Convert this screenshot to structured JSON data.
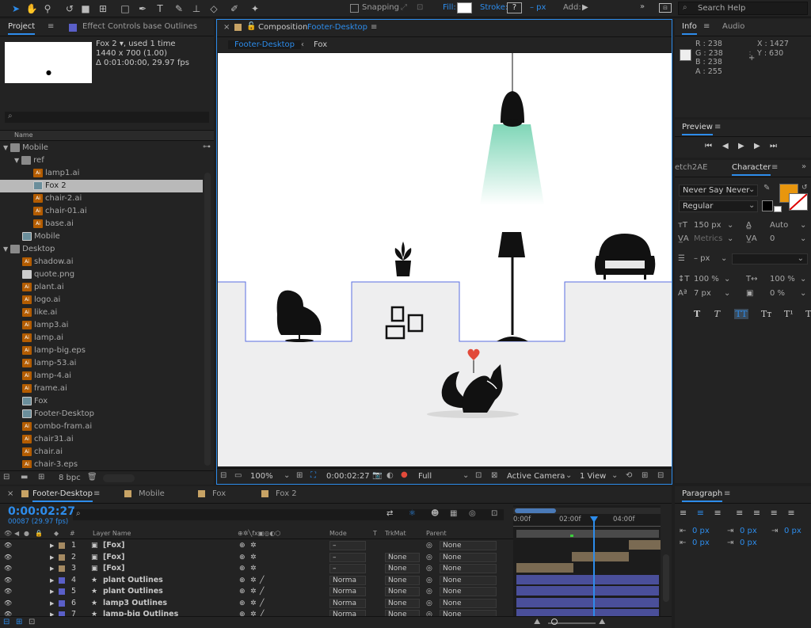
{
  "toolbar": {
    "snapping": "Snapping",
    "fill": "Fill:",
    "stroke": "Stroke:",
    "stroke_value": "?",
    "px": "– px",
    "add": "Add:",
    "search": "Search Help"
  },
  "project": {
    "tab_project": "Project",
    "tab_effect": "Effect Controls base Outlines",
    "item_name": "Fox 2 ▾, used 1 time",
    "item_size": "1440 x 700 (1.00)",
    "item_dur": "Δ 0:01:00:00, 29.97 fps",
    "col_name": "Name",
    "bpc": "8 bpc",
    "items": [
      {
        "label": "Mobile",
        "type": "fold"
      },
      {
        "label": "ref",
        "type": "fold"
      },
      {
        "label": "lamp1.ai",
        "type": "ai"
      },
      {
        "label": "Fox 2",
        "type": "comp"
      },
      {
        "label": "chair-2.ai",
        "type": "ai"
      },
      {
        "label": "chair-01.ai",
        "type": "ai"
      },
      {
        "label": "base.ai",
        "type": "ai"
      },
      {
        "label": "Mobile",
        "type": "comp"
      },
      {
        "label": "Desktop",
        "type": "fold"
      },
      {
        "label": "shadow.ai",
        "type": "ai"
      },
      {
        "label": "quote.png",
        "type": "png"
      },
      {
        "label": "plant.ai",
        "type": "ai"
      },
      {
        "label": "logo.ai",
        "type": "ai"
      },
      {
        "label": "like.ai",
        "type": "ai"
      },
      {
        "label": "lamp3.ai",
        "type": "ai"
      },
      {
        "label": "lamp.ai",
        "type": "ai"
      },
      {
        "label": "lamp-big.eps",
        "type": "ai"
      },
      {
        "label": "lamp-53.ai",
        "type": "ai"
      },
      {
        "label": "lamp-4.ai",
        "type": "ai"
      },
      {
        "label": "frame.ai",
        "type": "ai"
      },
      {
        "label": "Fox",
        "type": "comp"
      },
      {
        "label": "Footer-Desktop",
        "type": "comp"
      },
      {
        "label": "combo-fram.ai",
        "type": "ai"
      },
      {
        "label": "chair31.ai",
        "type": "ai"
      },
      {
        "label": "chair.ai",
        "type": "ai"
      },
      {
        "label": "chair-3.eps",
        "type": "ai"
      }
    ]
  },
  "composition": {
    "tab_prefix": "Composition",
    "tab_name": "Footer-Desktop",
    "crumb1": "Footer-Desktop",
    "crumb2": "Fox",
    "zoom": "100%",
    "time": "0:00:02:27",
    "res": "Full",
    "camera": "Active Camera",
    "view": "1 View"
  },
  "info": {
    "tab": "Info",
    "tab2": "Audio",
    "r": "R : 238",
    "g": "G : 238",
    "b": "B : 238",
    "a": "A : 255",
    "x": "X : 1427",
    "y": "Y : 630"
  },
  "preview": {
    "tab": "Preview"
  },
  "character": {
    "tab_left": "etch2AE",
    "tab": "Character",
    "font": "Never Say Never",
    "style": "Regular",
    "size": "150 px",
    "leading": "Auto",
    "kern": "Metrics",
    "track": "0",
    "stroke_px": "– px",
    "vscale": "100 %",
    "hscale": "100 %",
    "baseline": "7 px",
    "tsume": "0 %",
    "swatch": "#e8960e"
  },
  "paragraph": {
    "tab": "Paragraph",
    "v1": "0 px",
    "v2": "0 px",
    "v3": "0 px",
    "v4": "0 px",
    "v5": "0 px"
  },
  "timeline": {
    "tabs": [
      "Footer-Desktop",
      "Mobile",
      "Fox",
      "Fox 2"
    ],
    "time": "0:00:02:27",
    "frames": "00087 (29.97 fps)",
    "col_layer": "Layer Name",
    "col_mode": "Mode",
    "col_t": "T",
    "col_trk": "TrkMat",
    "col_parent": "Parent",
    "ruler": [
      "0:00f",
      "02:00f",
      "04:00f"
    ],
    "layers": [
      {
        "num": "1",
        "name": "[Fox]",
        "mode": "–",
        "trk": "",
        "parent": "None",
        "color": "#a58a62"
      },
      {
        "num": "2",
        "name": "[Fox]",
        "mode": "–",
        "trk": "None",
        "parent": "None",
        "color": "#a58a62"
      },
      {
        "num": "3",
        "name": "[Fox]",
        "mode": "–",
        "trk": "None",
        "parent": "None",
        "color": "#a58a62"
      },
      {
        "num": "4",
        "name": "plant Outlines",
        "mode": "Norma",
        "trk": "None",
        "parent": "None",
        "color": "#5a5fc8"
      },
      {
        "num": "5",
        "name": "plant Outlines",
        "mode": "Norma",
        "trk": "None",
        "parent": "None",
        "color": "#5a5fc8"
      },
      {
        "num": "6",
        "name": "lamp3 Outlines",
        "mode": "Norma",
        "trk": "None",
        "parent": "None",
        "color": "#5a5fc8"
      },
      {
        "num": "7",
        "name": "lamp-big Outlines",
        "mode": "Norma",
        "trk": "None",
        "parent": "None",
        "color": "#5a5fc8"
      }
    ]
  }
}
